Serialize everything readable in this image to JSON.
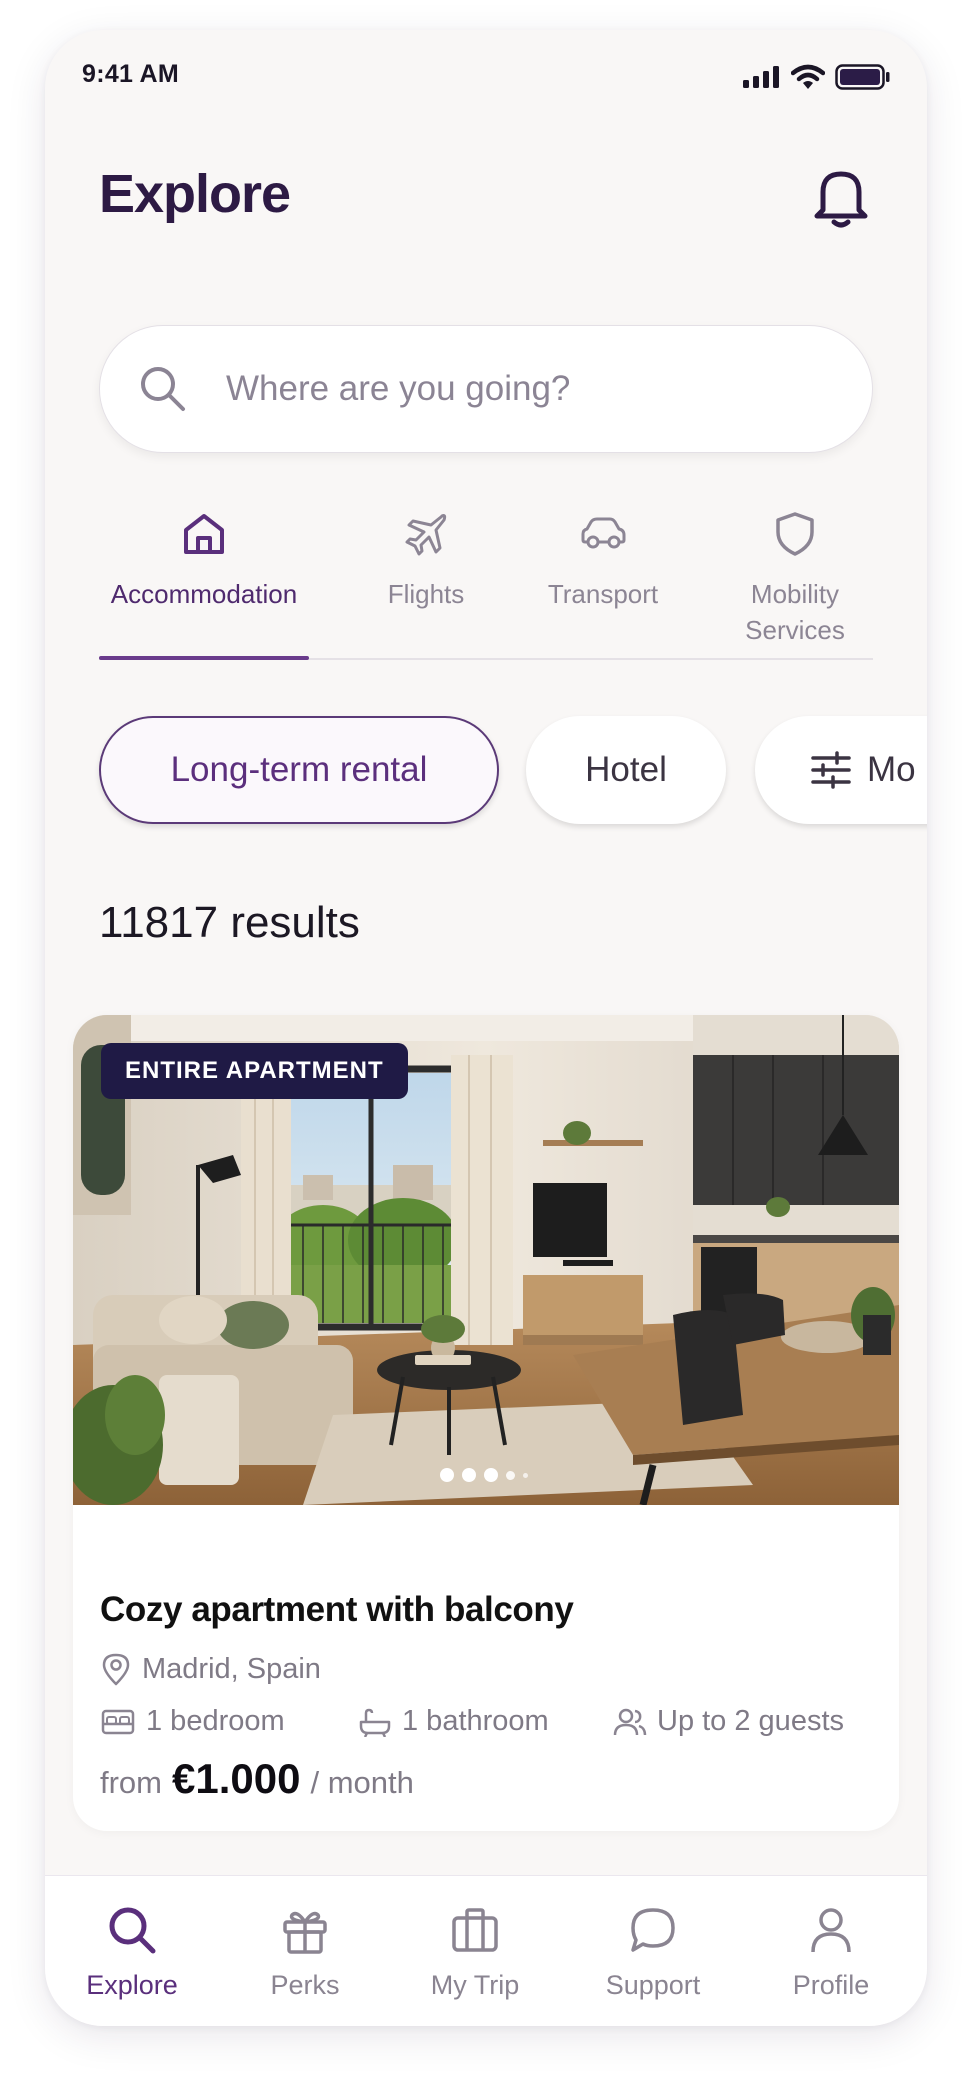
{
  "status_bar": {
    "time": "9:41 AM"
  },
  "header": {
    "title": "Explore"
  },
  "search": {
    "placeholder": "Where are you going?"
  },
  "categories": [
    {
      "label": "Accommodation",
      "icon": "home-icon",
      "active": true
    },
    {
      "label": "Flights",
      "icon": "plane-icon",
      "active": false
    },
    {
      "label": "Transport",
      "icon": "car-icon",
      "active": false
    },
    {
      "label": "Mobility",
      "label2": "Services",
      "icon": "shield-icon",
      "active": false
    }
  ],
  "chips": [
    {
      "label": "Long-term rental",
      "selected": true
    },
    {
      "label": "Hotel",
      "selected": false
    },
    {
      "label": "Mo",
      "icon": "sliders-icon",
      "selected": false
    }
  ],
  "results": {
    "count_text": "11817 results"
  },
  "listing": {
    "badge": "ENTIRE APARTMENT",
    "title": "Cozy apartment with balcony",
    "location": "Madrid, Spain",
    "bedrooms": "1 bedroom",
    "bathrooms": "1 bathroom",
    "guests": "Up to 2 guests",
    "price_prefix": "from",
    "price": "€1.000",
    "price_period": "/ month",
    "photo_index": 3,
    "photo_count": 5
  },
  "bottom_nav": [
    {
      "label": "Explore",
      "icon": "search-icon",
      "active": true
    },
    {
      "label": "Perks",
      "icon": "gift-icon",
      "active": false
    },
    {
      "label": "My Trip",
      "icon": "briefcase-icon",
      "active": false
    },
    {
      "label": "Support",
      "icon": "chat-bubble-icon",
      "active": false
    },
    {
      "label": "Profile",
      "icon": "user-icon",
      "active": false
    }
  ],
  "colors": {
    "brand": "#5a2f7c",
    "title": "#2d1a44",
    "badge_bg": "#1f1a45",
    "background": "#f9f7f6"
  }
}
